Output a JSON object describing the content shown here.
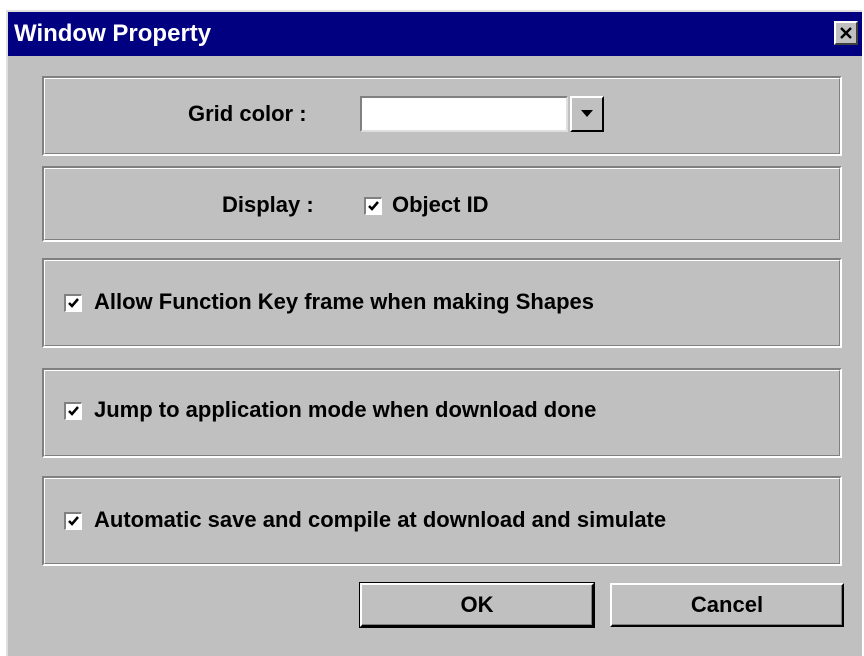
{
  "window": {
    "title": "Window Property",
    "close_icon": "close-icon"
  },
  "grid": {
    "label": "Grid  color :",
    "color_value": "#ffffff"
  },
  "display": {
    "label": "Display :",
    "object_id_label": "Object ID",
    "object_id_checked": true
  },
  "options": [
    {
      "label": "Allow Function Key frame when making Shapes",
      "checked": true
    },
    {
      "label": "Jump to application mode when download done",
      "checked": true
    },
    {
      "label": "Automatic save and compile at download and simulate",
      "checked": true
    }
  ],
  "buttons": {
    "ok": "OK",
    "cancel": "Cancel"
  },
  "colors": {
    "titlebar": "#000080",
    "face": "#c0c0c0"
  }
}
